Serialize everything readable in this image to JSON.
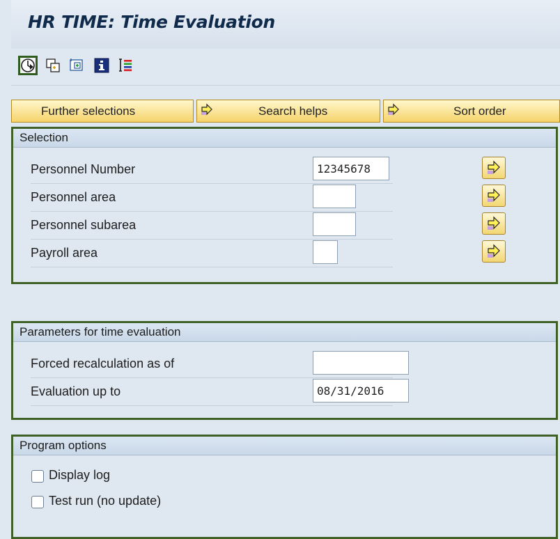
{
  "window": {
    "title": "HR TIME: Time Evaluation"
  },
  "toolbar": {
    "icons": [
      "execute-icon",
      "copy-variant-icon",
      "get-variant-icon",
      "info-icon",
      "selection-options-icon"
    ]
  },
  "tabs": {
    "further_selections": "Further selections",
    "search_helps": "Search helps",
    "sort_order": "Sort order"
  },
  "selection": {
    "header": "Selection",
    "fields": [
      {
        "label": "Personnel Number",
        "value": "12345678"
      },
      {
        "label": "Personnel area",
        "value": ""
      },
      {
        "label": "Personnel subarea",
        "value": ""
      },
      {
        "label": "Payroll area",
        "value": ""
      }
    ]
  },
  "parameters": {
    "header": "Parameters for time evaluation",
    "forced_recalc_label": "Forced recalculation as of",
    "forced_recalc_value": "",
    "evaluation_label": "Evaluation up to",
    "evaluation_value": "08/31/2016"
  },
  "options": {
    "header": "Program options",
    "display_log": {
      "label": "Display log",
      "checked": false
    },
    "test_run": {
      "label": "Test run (no update)",
      "checked": false
    }
  },
  "colors": {
    "group_border": "#3f6127",
    "button_yellow": "#f6d36b",
    "background": "#dfe7f1"
  }
}
